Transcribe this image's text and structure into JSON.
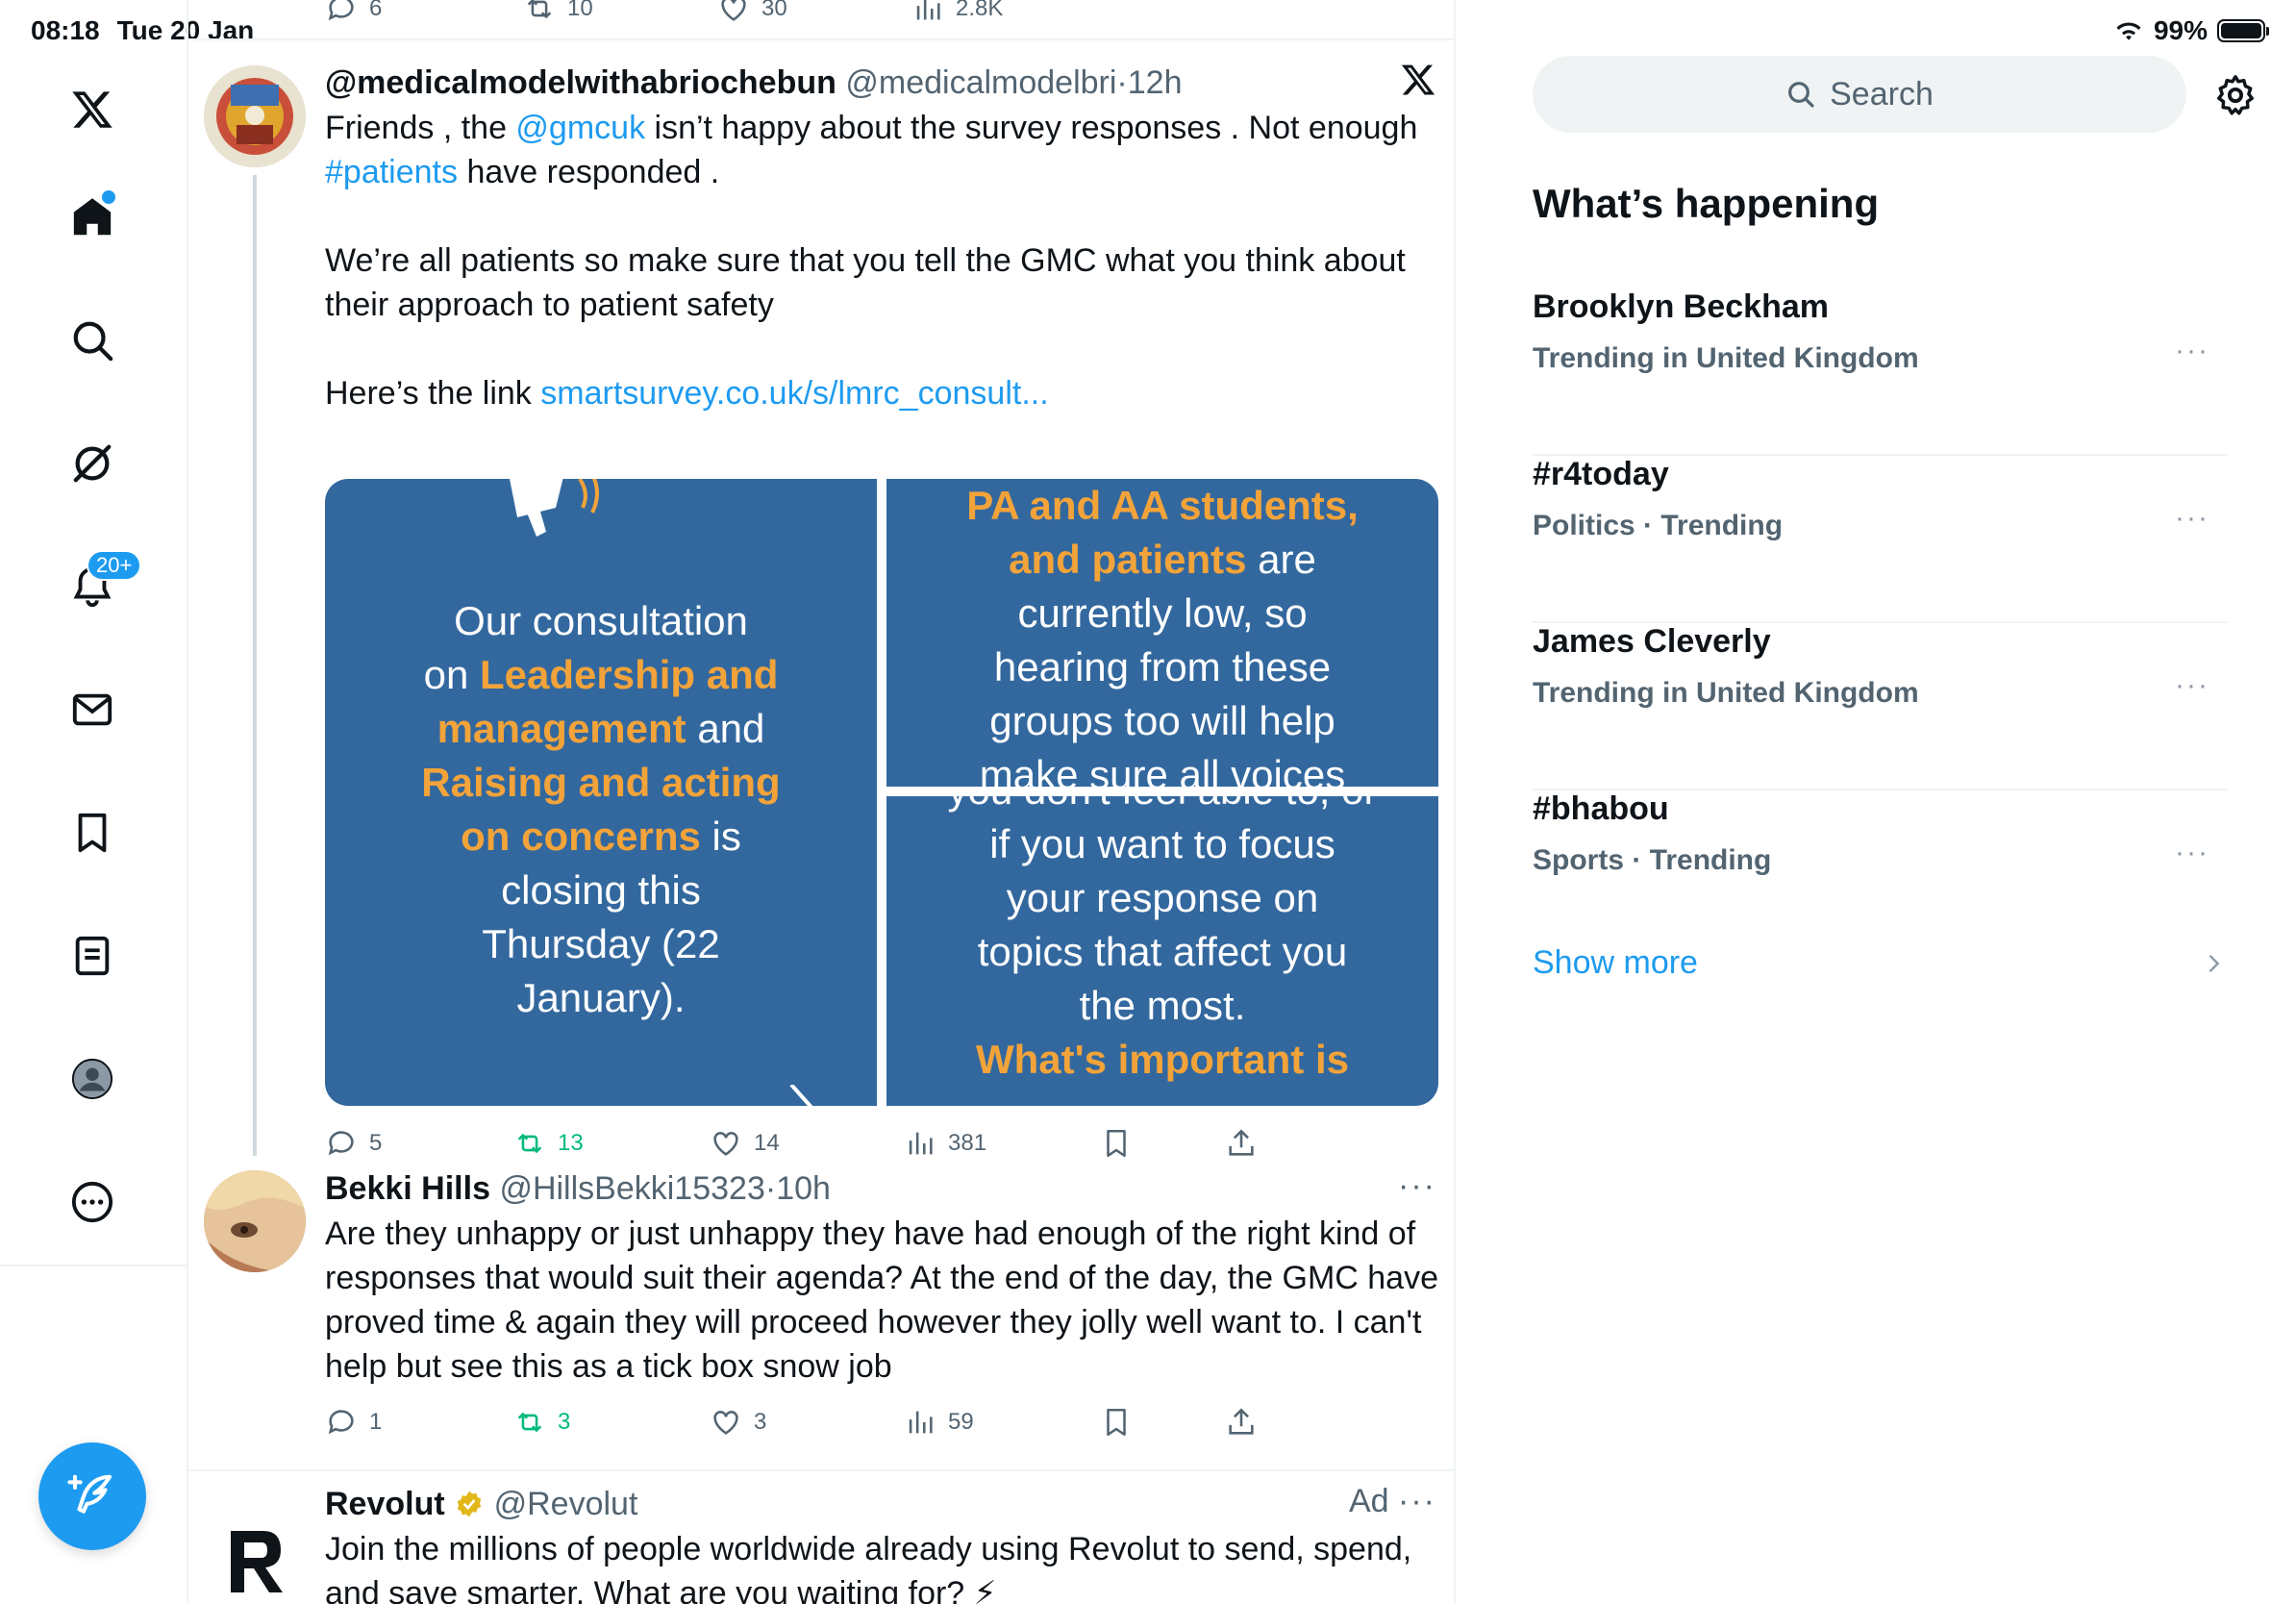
{
  "status": {
    "time": "08:18",
    "date": "Tue 20 Jan",
    "battery": "99%"
  },
  "nav": {
    "notifications_badge": "20+"
  },
  "top_actions": {
    "replies": "6",
    "reposts": "10",
    "likes": "30",
    "views": "2.8K"
  },
  "tweet1": {
    "name": "@medicalmodelwithabriochebun",
    "handle": "@medicalmodelbri",
    "time": "12h",
    "line1_a": "Friends , the ",
    "mention": "@gmcuk",
    "line1_b": " isn’t happy about the survey responses . Not enough",
    "hashtag": "#patients",
    "line2_b": " have responded .",
    "para2": "We’re all patients so make sure that you tell the GMC what you think about their approach to patient safety",
    "link_prefix": "Here’s the link ",
    "link": "smartsurvey.co.uk/s/lmrc_consult...",
    "replies": "5",
    "reposts": "13",
    "likes": "14",
    "views": "381",
    "media": {
      "left_1": "Our consultation",
      "left_2a": "on ",
      "left_2b": "Leadership and",
      "left_3a": "management",
      "left_3b": " and",
      "left_4": "Raising and acting",
      "left_5a": "on concerns",
      "left_5b": " is",
      "left_6": "closing this",
      "left_7": "Thursday (22",
      "left_8": "January).",
      "tr_1": "PA and AA students,",
      "tr_2a": "and patients",
      "tr_2b": " are",
      "tr_3": "currently low, so",
      "tr_4": "hearing from these",
      "tr_5": "groups too will help",
      "tr_6": "make sure all voices",
      "br_0": "you don't feel able to, or",
      "br_1": "if you want to focus",
      "br_2": "your response on",
      "br_3": "topics that affect you",
      "br_4": "the most.",
      "br_5": "What's important is"
    }
  },
  "tweet2": {
    "name": "Bekki Hills",
    "handle": "@HillsBekki15323",
    "time": "10h",
    "text": "Are they unhappy or just unhappy they have had enough of the right kind of responses that would suit their agenda? At the end of the day, the GMC have proved time & again they will proceed however they jolly well want to. I can't help but see this as a tick box snow job",
    "replies": "1",
    "reposts": "3",
    "likes": "3",
    "views": "59"
  },
  "tweet3": {
    "name": "Revolut",
    "handle": "@Revolut",
    "ad": "Ad",
    "text": "Join the millions of people worldwide already using Revolut to send, spend, and save smarter. What are you waiting for? ⚡"
  },
  "right": {
    "search_placeholder": "Search",
    "whats_happening": "What’s happening",
    "trends": [
      {
        "name": "Brooklyn Beckham",
        "meta": "Trending in United Kingdom"
      },
      {
        "name": "#r4today",
        "meta": "Politics · Trending"
      },
      {
        "name": "James Cleverly",
        "meta": "Trending in United Kingdom"
      },
      {
        "name": "#bhabou",
        "meta": "Sports · Trending"
      }
    ],
    "show_more": "Show more"
  },
  "colors": {
    "accent": "#1d9bf0",
    "repost": "#00ba7c",
    "media_bg": "#33689e",
    "media_highlight": "#f2a33a"
  }
}
